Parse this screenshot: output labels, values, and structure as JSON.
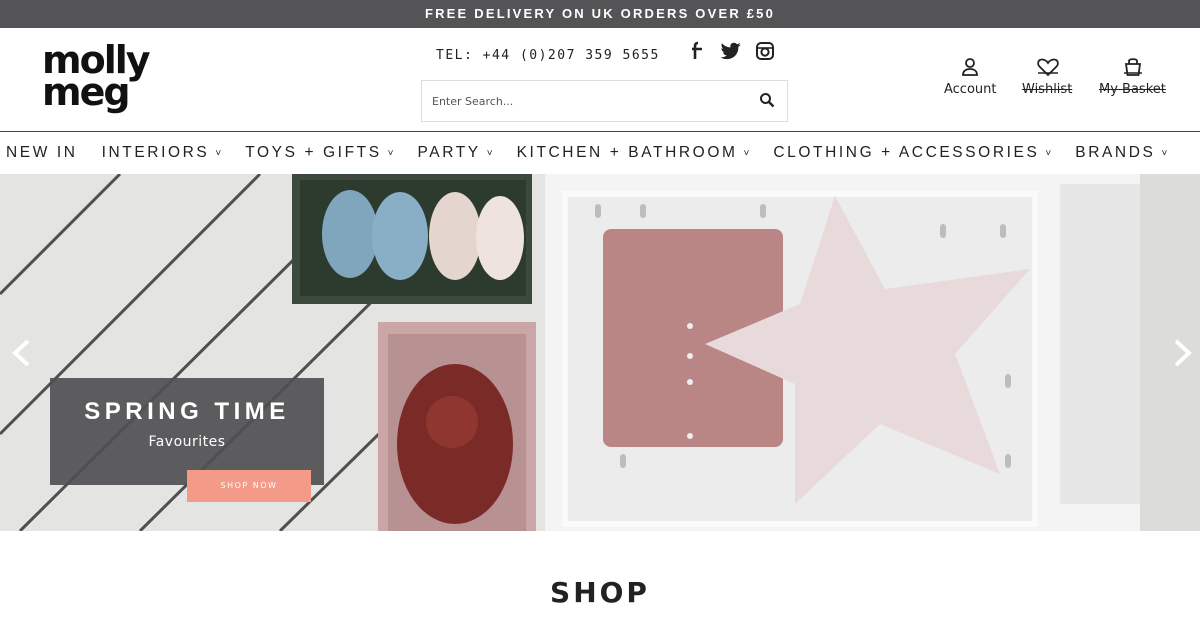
{
  "promo": {
    "text": "FREE DELIVERY ON UK ORDERS OVER £50"
  },
  "header": {
    "logo_line1": "molly",
    "logo_line2": "meg",
    "tel": "TEL: +44 (0)207 359 5655",
    "social_icons": [
      "facebook-icon",
      "twitter-icon",
      "instagram-icon"
    ],
    "search": {
      "placeholder": "Enter Search..."
    },
    "account_label": "Account",
    "wishlist_label": "Wishlist",
    "basket_label": "My Basket"
  },
  "nav": {
    "items": [
      {
        "label": "NEW IN",
        "dropdown": false
      },
      {
        "label": "INTERIORS",
        "dropdown": true
      },
      {
        "label": "TOYS + GIFTS",
        "dropdown": true
      },
      {
        "label": "PARTY",
        "dropdown": true
      },
      {
        "label": "KITCHEN + BATHROOM",
        "dropdown": true
      },
      {
        "label": "CLOTHING + ACCESSORIES",
        "dropdown": true
      },
      {
        "label": "BRANDS",
        "dropdown": true
      }
    ]
  },
  "hero": {
    "title": "SPRING TIME",
    "subtitle": "Favourites",
    "cta": "SHOP NOW"
  },
  "section": {
    "heading": "SHOP"
  },
  "colors": {
    "promo_bg": "#545456",
    "cta": "#f49a89",
    "banner_bg": "#505052"
  }
}
